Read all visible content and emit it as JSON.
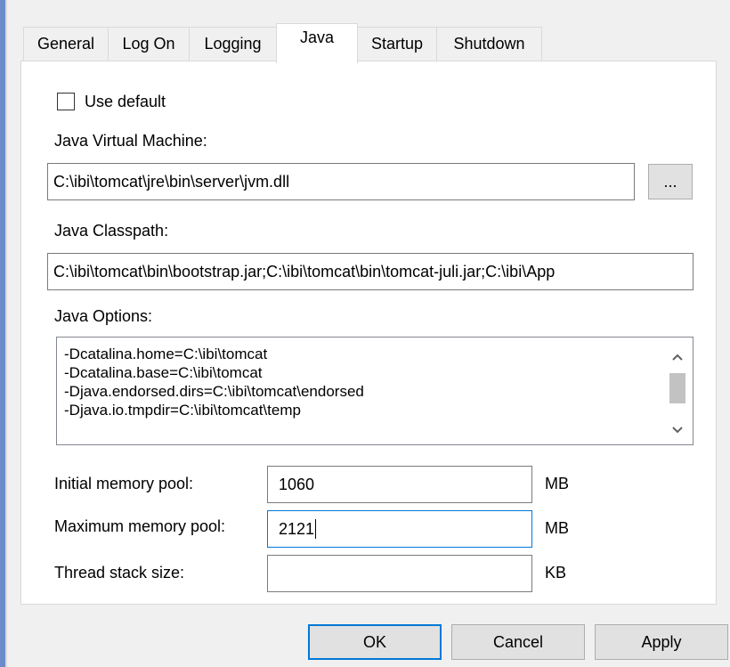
{
  "tabs": [
    {
      "label": "General"
    },
    {
      "label": "Log On"
    },
    {
      "label": "Logging"
    },
    {
      "label": "Java"
    },
    {
      "label": "Startup"
    },
    {
      "label": "Shutdown"
    }
  ],
  "active_tab": "Java",
  "use_default": {
    "label": "Use default",
    "checked": false
  },
  "jvm": {
    "label": "Java Virtual Machine:",
    "value": "C:\\ibi\\tomcat\\jre\\bin\\server\\jvm.dll",
    "browse_label": "..."
  },
  "classpath": {
    "label": "Java Classpath:",
    "value": "C:\\ibi\\tomcat\\bin\\bootstrap.jar;C:\\ibi\\tomcat\\bin\\tomcat-juli.jar;C:\\ibi\\App"
  },
  "options": {
    "label": "Java Options:",
    "lines": [
      "-Dcatalina.home=C:\\ibi\\tomcat",
      "-Dcatalina.base=C:\\ibi\\tomcat",
      "-Djava.endorsed.dirs=C:\\ibi\\tomcat\\endorsed",
      "-Djava.io.tmpdir=C:\\ibi\\tomcat\\temp"
    ]
  },
  "memory": {
    "initial": {
      "label": "Initial memory pool:",
      "value": "1060",
      "unit": "MB"
    },
    "maximum": {
      "label": "Maximum memory pool:",
      "value": "2121",
      "unit": "MB"
    },
    "thread": {
      "label": "Thread stack size:",
      "value": "",
      "unit": "KB"
    }
  },
  "buttons": {
    "ok": "OK",
    "cancel": "Cancel",
    "apply": "Apply"
  },
  "colors": {
    "focus_accent": "#0078d7",
    "window_bg": "#f0f0f0",
    "panel_bg": "#ffffff"
  }
}
